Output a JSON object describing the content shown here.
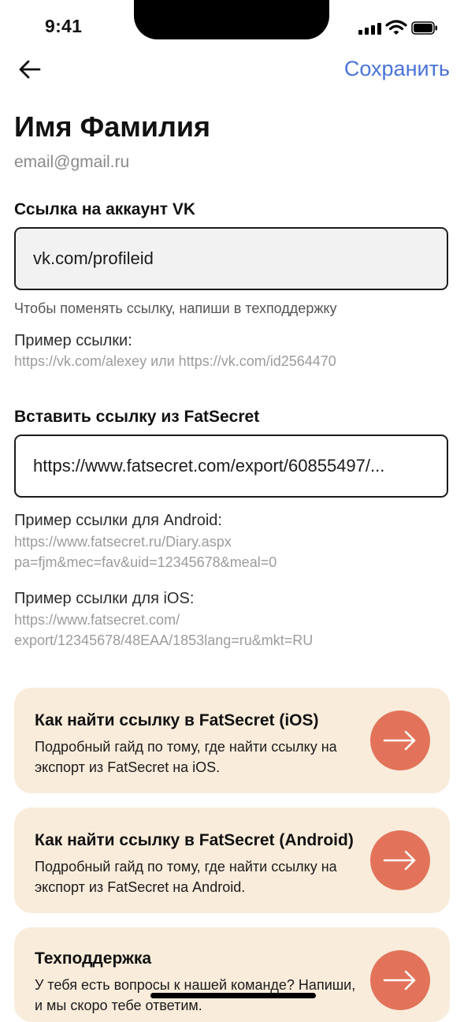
{
  "status_bar": {
    "time": "9:41"
  },
  "nav": {
    "save_label": "Сохранить"
  },
  "profile": {
    "name": "Имя Фамилия",
    "email": "email@gmail.ru"
  },
  "vk": {
    "label": "Ссылка на аккаунт VK",
    "value": "vk.com/profileid",
    "hint": "Чтобы поменять ссылку, напиши в техподдержку",
    "example_title": "Пример ссылки:",
    "example_text": "https://vk.com/alexey или https://vk.com/id2564470"
  },
  "fatsecret": {
    "label": "Вставить ссылку из FatSecret",
    "value": "https://www.fatsecret.com/export/60855497/...",
    "android_title": "Пример ссылки для Android:",
    "android_line1": "https://www.fatsecret.ru/Diary.aspx",
    "android_line2": "pa=fjm&mec=fav&uid=12345678&meal=0",
    "ios_title": "Пример ссылки для iOS:",
    "ios_line1": "https://www.fatsecret.com/",
    "ios_line2": "export/12345678/48EAA/1853lang=ru&mkt=RU"
  },
  "cards": [
    {
      "title": "Как найти ссылку в FatSecret (iOS)",
      "desc": "Подробный гайд по тому, где найти ссылку на экспорт из FatSecret на iOS."
    },
    {
      "title": "Как найти ссылку в FatSecret (Android)",
      "desc": "Подробный гайд по тому, где найти ссылку на экспорт из FatSecret на Android."
    },
    {
      "title": "Техподдержка",
      "desc": "У тебя есть вопросы к нашей команде? Напиши, и мы скоро тебе ответим."
    }
  ],
  "colors": {
    "accent": "#4a73d9",
    "card_bg": "#f9ecdb",
    "arrow_bg": "#e2735a"
  },
  "icons": {
    "back": "arrow-left-icon",
    "card_arrow": "arrow-right-icon"
  }
}
